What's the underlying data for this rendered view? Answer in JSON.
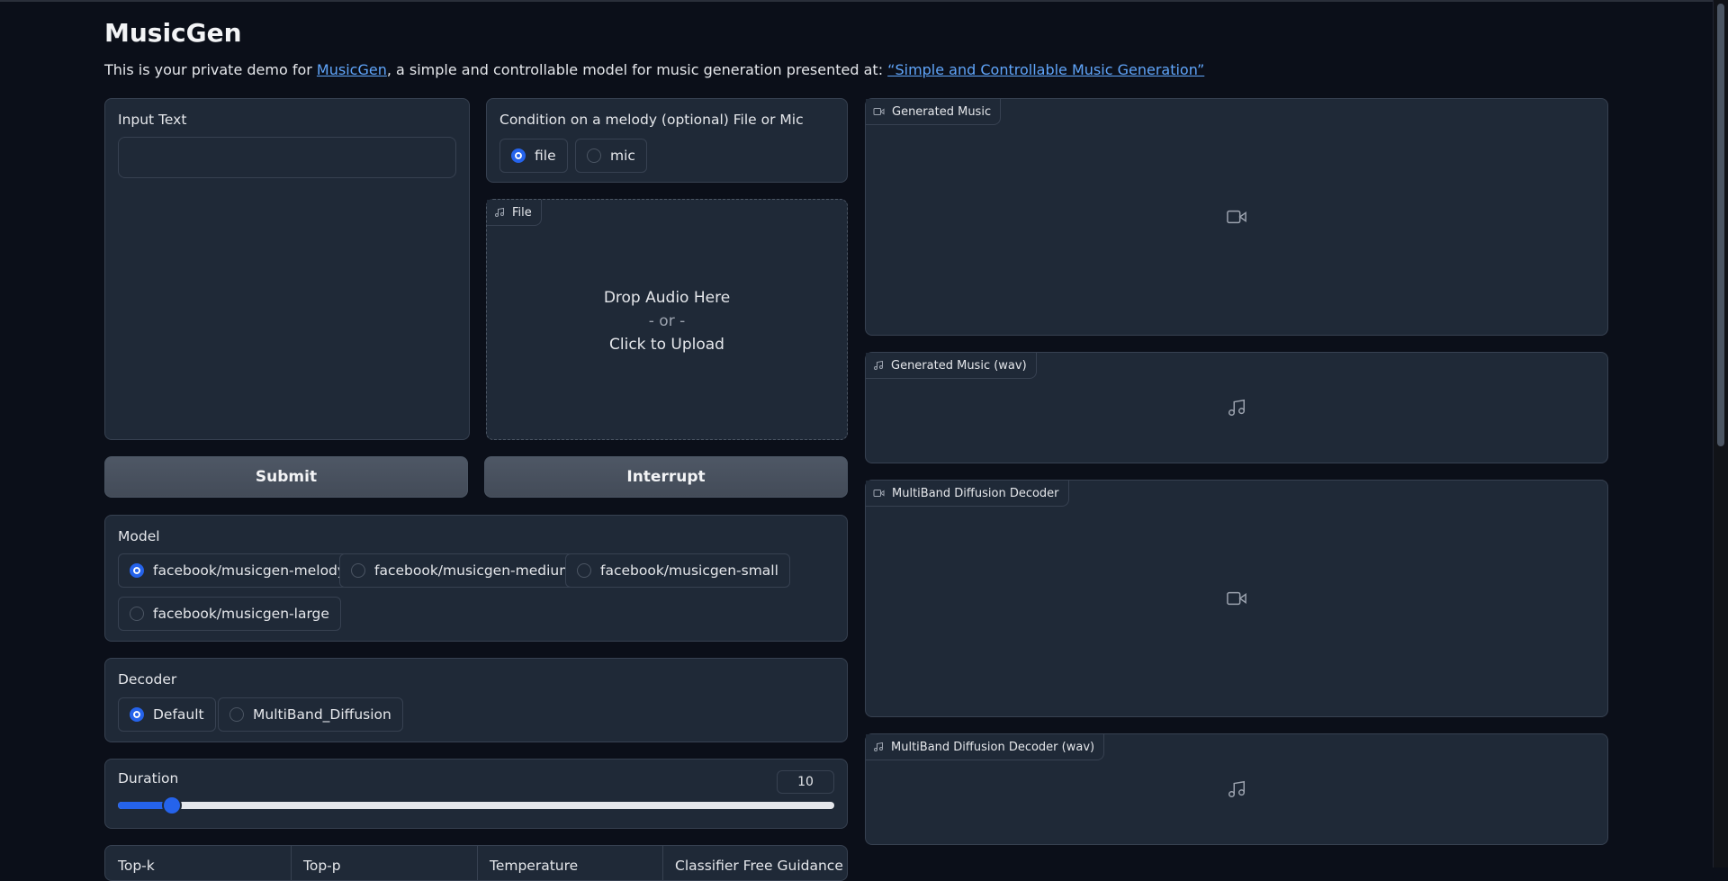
{
  "app": {
    "title": "MusicGen",
    "description_prefix": "This is your private demo for ",
    "musicgen_link": "MusicGen",
    "description_middle": ", a simple and controllable model for music generation presented at: ",
    "paper_link": "“Simple and Controllable Music Generation”"
  },
  "input_text": {
    "label": "Input Text",
    "value": ""
  },
  "melody": {
    "label": "Condition on a melody (optional) File or Mic",
    "options": [
      "file",
      "mic"
    ],
    "selected": "file"
  },
  "file_upload": {
    "tag": "File",
    "drop_text": "Drop Audio Here",
    "or_text": "- or -",
    "click_text": "Click to Upload"
  },
  "buttons": {
    "submit": "Submit",
    "interrupt": "Interrupt"
  },
  "model": {
    "label": "Model",
    "options": [
      "facebook/musicgen-melody",
      "facebook/musicgen-medium",
      "facebook/musicgen-small",
      "facebook/musicgen-large"
    ],
    "selected": "facebook/musicgen-melody"
  },
  "decoder": {
    "label": "Decoder",
    "options": [
      "Default",
      "MultiBand_Diffusion"
    ],
    "selected": "Default"
  },
  "duration": {
    "label": "Duration",
    "value": "10",
    "min": 1,
    "max": 120
  },
  "params": {
    "top_k": "Top-k",
    "top_p": "Top-p",
    "temperature": "Temperature",
    "cfg": "Classifier Free Guidance"
  },
  "outputs": {
    "generated_music": "Generated Music",
    "generated_music_wav": "Generated Music (wav)",
    "mbd": "MultiBand Diffusion Decoder",
    "mbd_wav": "MultiBand Diffusion Decoder (wav)"
  },
  "icons": {
    "video": "video-camera-icon",
    "music": "music-note-icon"
  },
  "colors": {
    "accent": "#2563eb",
    "link": "#60a5fa",
    "background": "#0b0f19",
    "panel": "#1f2937"
  }
}
